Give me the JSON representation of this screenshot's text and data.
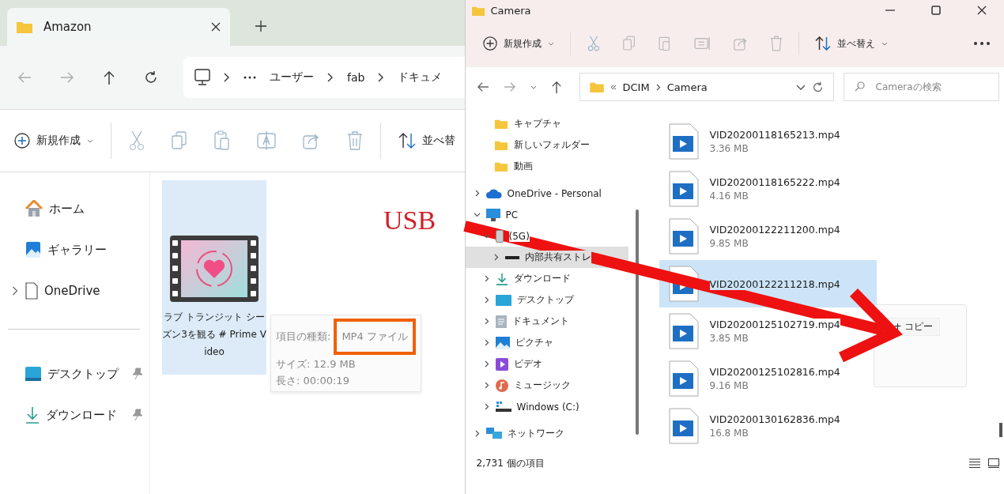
{
  "left_window": {
    "tabs": [
      {
        "label": "Amazon",
        "selected": true
      }
    ],
    "breadcrumb": [
      "ユーザー",
      "fab",
      "ドキュメ"
    ],
    "toolbar": {
      "new_label": "新規作成",
      "sort_label": "並べ替"
    },
    "sidebar": [
      {
        "label": "ホーム",
        "kind": "home",
        "expandable": false,
        "pinned": false
      },
      {
        "label": "ギャラリー",
        "kind": "gallery",
        "expandable": false,
        "pinned": false
      },
      {
        "label": "OneDrive",
        "kind": "document",
        "expandable": true,
        "pinned": false
      },
      {
        "label": "デスクトップ",
        "kind": "desktop",
        "expandable": false,
        "pinned": true
      },
      {
        "label": "ダウンロード",
        "kind": "download",
        "expandable": false,
        "pinned": true
      }
    ],
    "file": {
      "name": "ラブ トランジット シーズン3を観る # Prime Video",
      "selected": true
    },
    "tooltip": {
      "type_label": "項目の種類:",
      "type_value": "MP4 ファイル",
      "size": "サイズ: 12.9 MB",
      "length": "長さ: 00:00:19"
    }
  },
  "annotation": {
    "label": "USB"
  },
  "right_window": {
    "title": "Camera",
    "toolbar": {
      "new_label": "新規作成",
      "sort_label": "並べ替え"
    },
    "path": [
      "DCIM",
      "Camera"
    ],
    "search": {
      "placeholder": "Cameraの検索"
    },
    "folders": [
      {
        "label": "キャプチャ",
        "selected": false
      },
      {
        "label": "新しいフォルダー",
        "selected": false
      },
      {
        "label": "動画",
        "selected": false
      }
    ],
    "nav_tree": [
      {
        "label": "OneDrive - Personal",
        "kind": "cloud",
        "expanded": false,
        "selected": false
      },
      {
        "label": "PC",
        "kind": "pc",
        "expanded": true,
        "selected": false,
        "children": [
          {
            "label": "(5G)",
            "kind": "phone",
            "expanded": true,
            "selected": false,
            "children": [
              {
                "label": "内部共有ストレ",
                "kind": "drive",
                "expanded": false,
                "selected": true
              }
            ]
          },
          {
            "label": "ダウンロード",
            "kind": "download",
            "expanded": false,
            "selected": false
          },
          {
            "label": "デスクトップ",
            "kind": "desktop",
            "expanded": false,
            "selected": false
          },
          {
            "label": "ドキュメント",
            "kind": "document",
            "expanded": false,
            "selected": false
          },
          {
            "label": "ピクチャ",
            "kind": "pictures",
            "expanded": false,
            "selected": false
          },
          {
            "label": "ビデオ",
            "kind": "video",
            "expanded": false,
            "selected": false
          },
          {
            "label": "ミュージック",
            "kind": "music",
            "expanded": false,
            "selected": false
          },
          {
            "label": "Windows (C:)",
            "kind": "windows",
            "expanded": false,
            "selected": false
          }
        ]
      },
      {
        "label": "ネットワーク",
        "kind": "network",
        "expanded": false,
        "selected": false
      }
    ],
    "files": [
      {
        "name": "VID20200118165213.mp4",
        "size": "3.36 MB",
        "selected": false
      },
      {
        "name": "VID20200118165222.mp4",
        "size": "4.16 MB",
        "selected": false
      },
      {
        "name": "VID20200122211200.mp4",
        "size": "9.85 MB",
        "selected": false
      },
      {
        "name": "VID20200122211218.mp4",
        "selected": true
      },
      {
        "name": "VID20200125102719.mp4",
        "size": "3.85 MB",
        "selected": false
      },
      {
        "name": "VID20200125102816.mp4",
        "size": "9.16 MB",
        "selected": false
      },
      {
        "name": "VID20200130162836.mp4",
        "size": "16.8 MB",
        "selected": false
      }
    ],
    "drop_popup": {
      "label": "+ コピー"
    },
    "status_bar": {
      "count": "2,731 個の項目"
    }
  }
}
